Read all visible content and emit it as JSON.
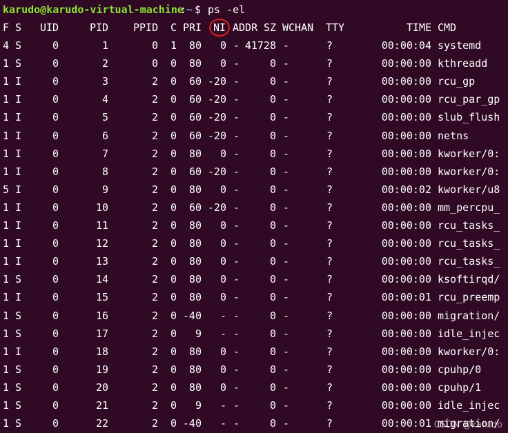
{
  "prompt": {
    "user_host": "karudo@karudo-virtual-machine",
    "separator": ":",
    "path": "~",
    "symbol": "$",
    "command": "ps -el"
  },
  "header": {
    "F": "F",
    "S": "S",
    "UID": "UID",
    "PID": "PID",
    "PPID": "PPID",
    "C": "C",
    "PRI": "PRI",
    "NI": "NI",
    "ADDR": "ADDR",
    "SZ": "SZ",
    "WCHAN": "WCHAN",
    "TTY": "TTY",
    "TIME": "TIME",
    "CMD": "CMD"
  },
  "rows": [
    {
      "f": "4",
      "s": "S",
      "uid": "0",
      "pid": "1",
      "ppid": "0",
      "c": "1",
      "pri": "80",
      "ni": "0",
      "addr": "-",
      "sz": "41728",
      "wchan": "-",
      "tty": "?",
      "time": "00:00:04",
      "cmd": "systemd"
    },
    {
      "f": "1",
      "s": "S",
      "uid": "0",
      "pid": "2",
      "ppid": "0",
      "c": "0",
      "pri": "80",
      "ni": "0",
      "addr": "-",
      "sz": "0",
      "wchan": "-",
      "tty": "?",
      "time": "00:00:00",
      "cmd": "kthreadd"
    },
    {
      "f": "1",
      "s": "I",
      "uid": "0",
      "pid": "3",
      "ppid": "2",
      "c": "0",
      "pri": "60",
      "ni": "-20",
      "addr": "-",
      "sz": "0",
      "wchan": "-",
      "tty": "?",
      "time": "00:00:00",
      "cmd": "rcu_gp"
    },
    {
      "f": "1",
      "s": "I",
      "uid": "0",
      "pid": "4",
      "ppid": "2",
      "c": "0",
      "pri": "60",
      "ni": "-20",
      "addr": "-",
      "sz": "0",
      "wchan": "-",
      "tty": "?",
      "time": "00:00:00",
      "cmd": "rcu_par_gp"
    },
    {
      "f": "1",
      "s": "I",
      "uid": "0",
      "pid": "5",
      "ppid": "2",
      "c": "0",
      "pri": "60",
      "ni": "-20",
      "addr": "-",
      "sz": "0",
      "wchan": "-",
      "tty": "?",
      "time": "00:00:00",
      "cmd": "slub_flush"
    },
    {
      "f": "1",
      "s": "I",
      "uid": "0",
      "pid": "6",
      "ppid": "2",
      "c": "0",
      "pri": "60",
      "ni": "-20",
      "addr": "-",
      "sz": "0",
      "wchan": "-",
      "tty": "?",
      "time": "00:00:00",
      "cmd": "netns"
    },
    {
      "f": "1",
      "s": "I",
      "uid": "0",
      "pid": "7",
      "ppid": "2",
      "c": "0",
      "pri": "80",
      "ni": "0",
      "addr": "-",
      "sz": "0",
      "wchan": "-",
      "tty": "?",
      "time": "00:00:00",
      "cmd": "kworker/0:"
    },
    {
      "f": "1",
      "s": "I",
      "uid": "0",
      "pid": "8",
      "ppid": "2",
      "c": "0",
      "pri": "60",
      "ni": "-20",
      "addr": "-",
      "sz": "0",
      "wchan": "-",
      "tty": "?",
      "time": "00:00:00",
      "cmd": "kworker/0:"
    },
    {
      "f": "5",
      "s": "I",
      "uid": "0",
      "pid": "9",
      "ppid": "2",
      "c": "0",
      "pri": "80",
      "ni": "0",
      "addr": "-",
      "sz": "0",
      "wchan": "-",
      "tty": "?",
      "time": "00:00:02",
      "cmd": "kworker/u8"
    },
    {
      "f": "1",
      "s": "I",
      "uid": "0",
      "pid": "10",
      "ppid": "2",
      "c": "0",
      "pri": "60",
      "ni": "-20",
      "addr": "-",
      "sz": "0",
      "wchan": "-",
      "tty": "?",
      "time": "00:00:00",
      "cmd": "mm_percpu_"
    },
    {
      "f": "1",
      "s": "I",
      "uid": "0",
      "pid": "11",
      "ppid": "2",
      "c": "0",
      "pri": "80",
      "ni": "0",
      "addr": "-",
      "sz": "0",
      "wchan": "-",
      "tty": "?",
      "time": "00:00:00",
      "cmd": "rcu_tasks_"
    },
    {
      "f": "1",
      "s": "I",
      "uid": "0",
      "pid": "12",
      "ppid": "2",
      "c": "0",
      "pri": "80",
      "ni": "0",
      "addr": "-",
      "sz": "0",
      "wchan": "-",
      "tty": "?",
      "time": "00:00:00",
      "cmd": "rcu_tasks_"
    },
    {
      "f": "1",
      "s": "I",
      "uid": "0",
      "pid": "13",
      "ppid": "2",
      "c": "0",
      "pri": "80",
      "ni": "0",
      "addr": "-",
      "sz": "0",
      "wchan": "-",
      "tty": "?",
      "time": "00:00:00",
      "cmd": "rcu_tasks_"
    },
    {
      "f": "1",
      "s": "S",
      "uid": "0",
      "pid": "14",
      "ppid": "2",
      "c": "0",
      "pri": "80",
      "ni": "0",
      "addr": "-",
      "sz": "0",
      "wchan": "-",
      "tty": "?",
      "time": "00:00:00",
      "cmd": "ksoftirqd/"
    },
    {
      "f": "1",
      "s": "I",
      "uid": "0",
      "pid": "15",
      "ppid": "2",
      "c": "0",
      "pri": "80",
      "ni": "0",
      "addr": "-",
      "sz": "0",
      "wchan": "-",
      "tty": "?",
      "time": "00:00:01",
      "cmd": "rcu_preemp"
    },
    {
      "f": "1",
      "s": "S",
      "uid": "0",
      "pid": "16",
      "ppid": "2",
      "c": "0",
      "pri": "-40",
      "ni": "-",
      "addr": "-",
      "sz": "0",
      "wchan": "-",
      "tty": "?",
      "time": "00:00:00",
      "cmd": "migration/"
    },
    {
      "f": "1",
      "s": "S",
      "uid": "0",
      "pid": "17",
      "ppid": "2",
      "c": "0",
      "pri": "9",
      "ni": "-",
      "addr": "-",
      "sz": "0",
      "wchan": "-",
      "tty": "?",
      "time": "00:00:00",
      "cmd": "idle_injec"
    },
    {
      "f": "1",
      "s": "I",
      "uid": "0",
      "pid": "18",
      "ppid": "2",
      "c": "0",
      "pri": "80",
      "ni": "0",
      "addr": "-",
      "sz": "0",
      "wchan": "-",
      "tty": "?",
      "time": "00:00:00",
      "cmd": "kworker/0:"
    },
    {
      "f": "1",
      "s": "S",
      "uid": "0",
      "pid": "19",
      "ppid": "2",
      "c": "0",
      "pri": "80",
      "ni": "0",
      "addr": "-",
      "sz": "0",
      "wchan": "-",
      "tty": "?",
      "time": "00:00:00",
      "cmd": "cpuhp/0"
    },
    {
      "f": "1",
      "s": "S",
      "uid": "0",
      "pid": "20",
      "ppid": "2",
      "c": "0",
      "pri": "80",
      "ni": "0",
      "addr": "-",
      "sz": "0",
      "wchan": "-",
      "tty": "?",
      "time": "00:00:00",
      "cmd": "cpuhp/1"
    },
    {
      "f": "1",
      "s": "S",
      "uid": "0",
      "pid": "21",
      "ppid": "2",
      "c": "0",
      "pri": "9",
      "ni": "-",
      "addr": "-",
      "sz": "0",
      "wchan": "-",
      "tty": "?",
      "time": "00:00:00",
      "cmd": "idle_injec"
    },
    {
      "f": "1",
      "s": "S",
      "uid": "0",
      "pid": "22",
      "ppid": "2",
      "c": "0",
      "pri": "-40",
      "ni": "-",
      "addr": "-",
      "sz": "0",
      "wchan": "-",
      "tty": "?",
      "time": "00:00:01",
      "cmd": "migration/"
    }
  ],
  "watermark": "CSDN @karudo",
  "colors": {
    "background": "#300a24",
    "text": "#ffffff",
    "prompt_user": "#8ae234",
    "prompt_path": "#729fcf",
    "highlight_ring": "#e0201b"
  }
}
